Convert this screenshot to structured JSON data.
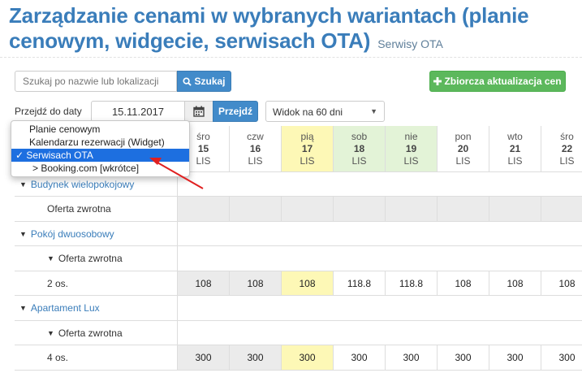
{
  "header": {
    "title": "Zarządzanie cenami w wybranych wariantach (planie cenowym, widgecie, serwisach OTA)",
    "subtitle": "Serwisy OTA"
  },
  "toolbar": {
    "search_placeholder": "Szukaj po nazwie lub lokalizacji",
    "search_label": "Szukaj",
    "bulk_update_label": "Zbiorcza aktualizacja cen",
    "go_to_date_label": "Przejdź do daty",
    "date_value": "15.11.2017",
    "go_label": "Przejdź",
    "view_select": "Widok na 60 dni"
  },
  "dropdown": {
    "items": [
      {
        "label": "Planie cenowym",
        "selected": false
      },
      {
        "label": "Kalendarzu rezerwacji (Widget)",
        "selected": false
      },
      {
        "label": "✓ Serwisach OTA",
        "selected": true
      },
      {
        "label": "> Booking.com [wkrótce]",
        "selected": false
      }
    ]
  },
  "days": [
    {
      "dow": "śro",
      "day": "15",
      "mon": "LIS",
      "hl": ""
    },
    {
      "dow": "czw",
      "day": "16",
      "mon": "LIS",
      "hl": ""
    },
    {
      "dow": "pią",
      "day": "17",
      "mon": "LIS",
      "hl": "yellow"
    },
    {
      "dow": "sob",
      "day": "18",
      "mon": "LIS",
      "hl": "green"
    },
    {
      "dow": "nie",
      "day": "19",
      "mon": "LIS",
      "hl": "green"
    },
    {
      "dow": "pon",
      "day": "20",
      "mon": "LIS",
      "hl": ""
    },
    {
      "dow": "wto",
      "day": "21",
      "mon": "LIS",
      "hl": ""
    },
    {
      "dow": "śro",
      "day": "22",
      "mon": "LIS",
      "hl": ""
    }
  ],
  "rows": [
    {
      "label": "Budynek wielopokojowy",
      "type": "group"
    },
    {
      "label": "Oferta zwrotna",
      "type": "offer-empty"
    },
    {
      "label": "Pokój dwuosobowy",
      "type": "group"
    },
    {
      "label": "Oferta zwrotna",
      "type": "offer"
    },
    {
      "label": "2 os.",
      "type": "price",
      "values": [
        "108",
        "108",
        "108",
        "118.8",
        "118.8",
        "108",
        "108",
        "108"
      ]
    },
    {
      "label": "Apartament Lux",
      "type": "group"
    },
    {
      "label": "Oferta zwrotna",
      "type": "offer"
    },
    {
      "label": "4 os.",
      "type": "price",
      "values": [
        "300",
        "300",
        "300",
        "300",
        "300",
        "300",
        "300",
        "300"
      ]
    }
  ],
  "colors": {
    "title": "#3a7dba",
    "primary_button": "#428bca",
    "success_button": "#5cb85c",
    "highlight_yellow": "#fdf8b6",
    "highlight_green": "#e3f3d7",
    "disabled_cell": "#ebebeb",
    "arrow": "#e02020"
  }
}
